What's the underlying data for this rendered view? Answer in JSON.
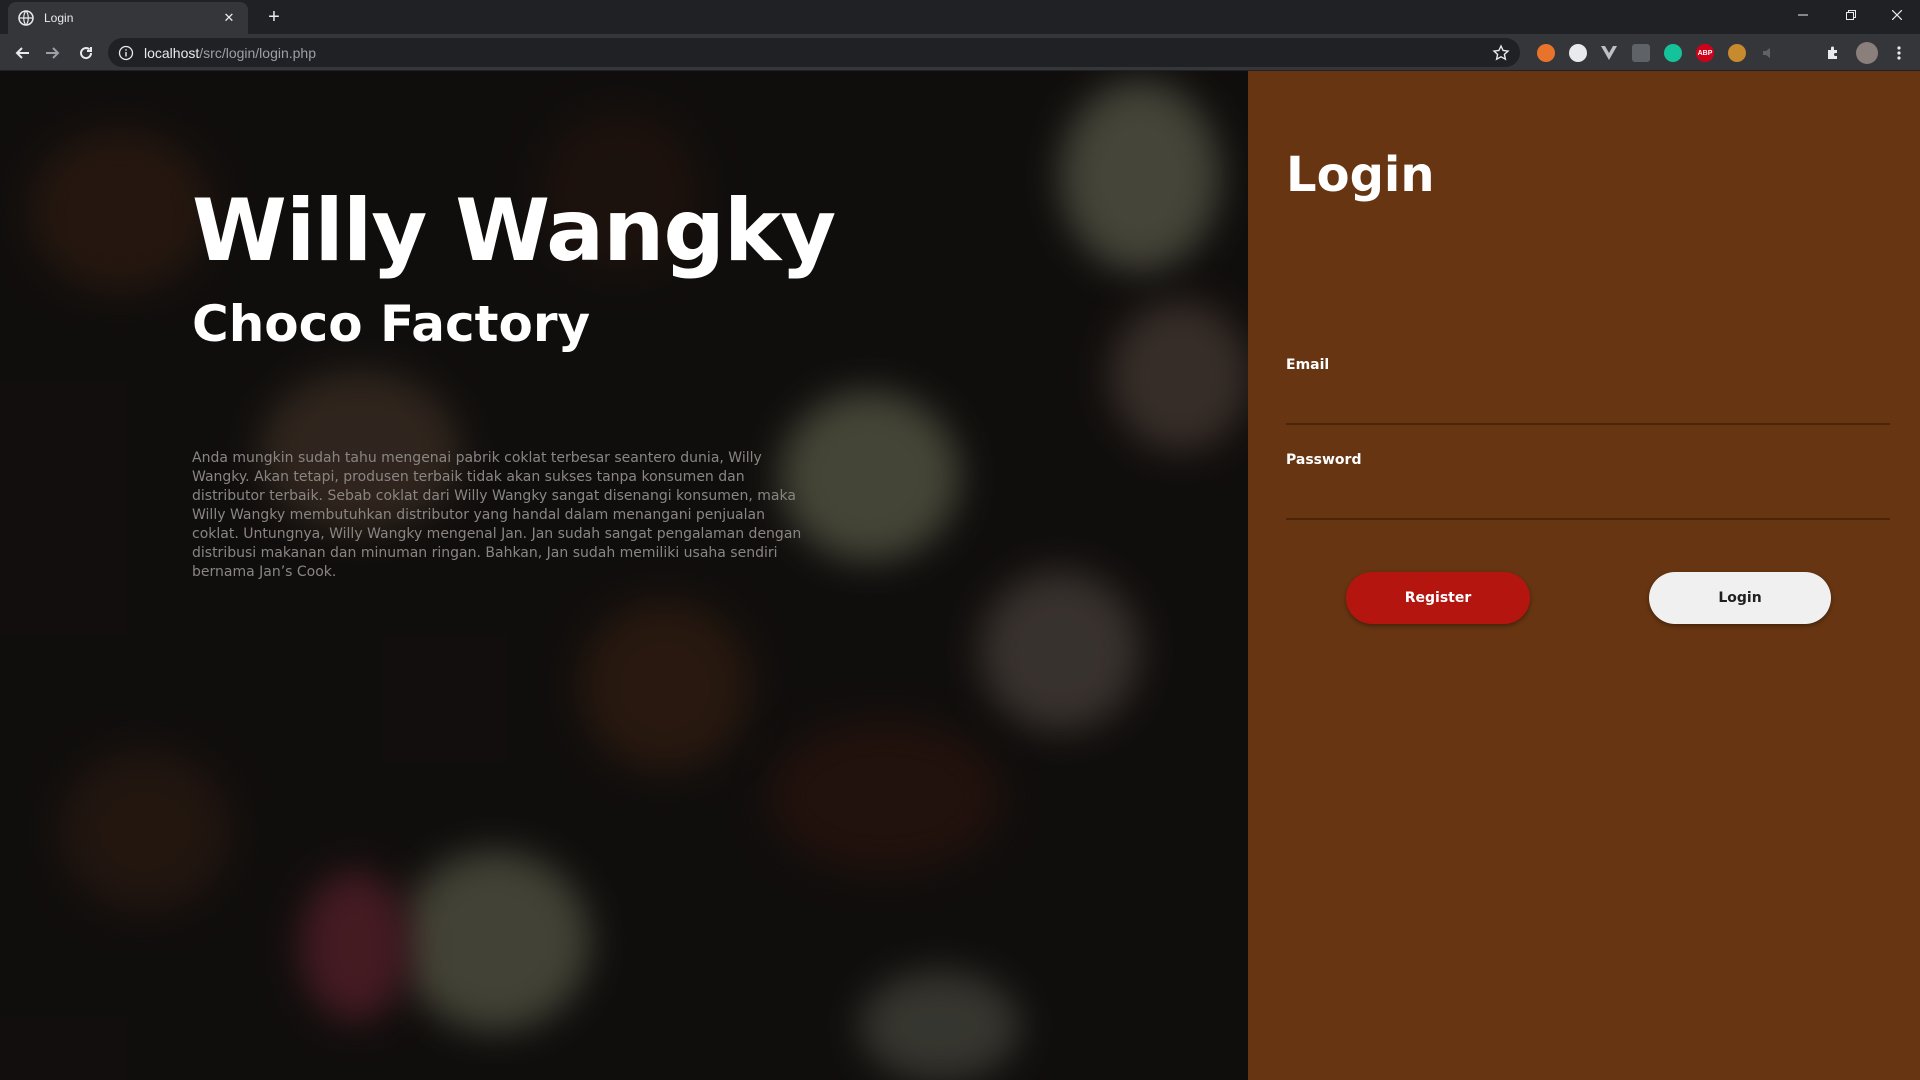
{
  "browser": {
    "tab_title": "Login",
    "new_tab_symbol": "+",
    "close_tab_symbol": "✕",
    "url_host": "localhost",
    "url_path": "/src/login/login.php",
    "extensions": [
      "metamask-icon",
      "circle-icon",
      "vue-devtools-icon",
      "screen-icon",
      "grammarly-icon",
      "adblock-plus-icon",
      "wappalyzer-icon",
      "sound-icon",
      "puzzle-icon",
      "profile-avatar-icon"
    ],
    "extension_abp_label": "ABP"
  },
  "hero": {
    "title": "Willy Wangky",
    "subtitle": "Choco Factory",
    "description": "Anda mungkin sudah tahu mengenai pabrik coklat terbesar seantero dunia, Willy Wangky. Akan tetapi, produsen terbaik tidak akan sukses tanpa konsumen dan distributor terbaik. Sebab coklat dari Willy Wangky sangat disenangi konsumen, maka Willy Wangky membutuhkan distributor yang handal dalam menangani penjualan coklat. Untungnya, Willy Wangky mengenal Jan. Jan sudah sangat pengalaman dengan distribusi makanan dan minuman ringan. Bahkan, Jan sudah memiliki usaha sendiri bernama Jan’s Cook."
  },
  "login_form": {
    "title": "Login",
    "email_label": "Email",
    "email_value": "",
    "password_label": "Password",
    "password_value": "",
    "register_button": "Register",
    "login_button": "Login"
  },
  "colors": {
    "panel": "#673511",
    "register": "#b5150f",
    "login_button": "#f0f0f0"
  }
}
